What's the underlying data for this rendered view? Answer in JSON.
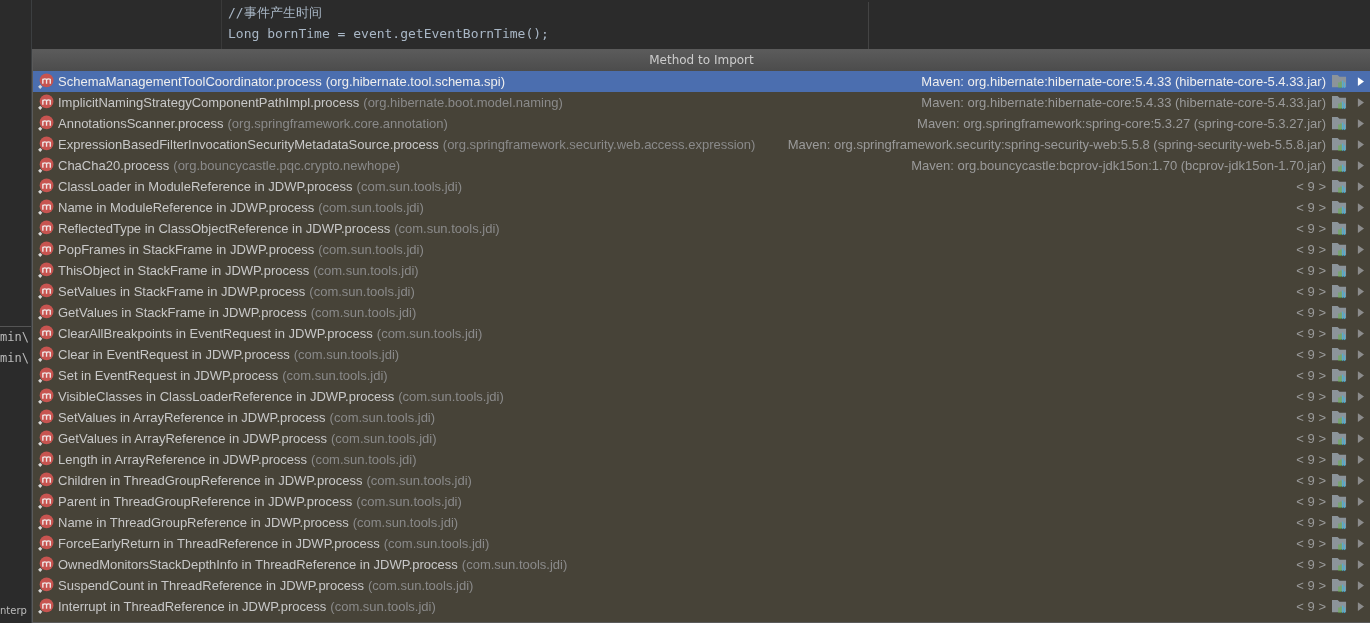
{
  "editor": {
    "lines": [
      "//事件产生时间",
      "Long bornTime = event.getEventBornTime();"
    ]
  },
  "side_panel": {
    "lines": [
      "min\\",
      "min\\",
      "nterp"
    ]
  },
  "popup": {
    "title": "Method to Import",
    "items": [
      {
        "name": "SchemaManagementToolCoordinator.process",
        "package": "(org.hibernate.tool.schema.spi)",
        "location": "Maven: org.hibernate:hibernate-core:5.4.33 (hibernate-core-5.4.33.jar)",
        "selected": true
      },
      {
        "name": "ImplicitNamingStrategyComponentPathImpl.process",
        "package": "(org.hibernate.boot.model.naming)",
        "location": "Maven: org.hibernate:hibernate-core:5.4.33 (hibernate-core-5.4.33.jar)",
        "selected": false
      },
      {
        "name": "AnnotationsScanner.process",
        "package": "(org.springframework.core.annotation)",
        "location": "Maven: org.springframework:spring-core:5.3.27 (spring-core-5.3.27.jar)",
        "selected": false
      },
      {
        "name": "ExpressionBasedFilterInvocationSecurityMetadataSource.process",
        "package": "(org.springframework.security.web.access.expression)",
        "location": "Maven: org.springframework.security:spring-security-web:5.5.8 (spring-security-web-5.5.8.jar)",
        "selected": false
      },
      {
        "name": "ChaCha20.process",
        "package": "(org.bouncycastle.pqc.crypto.newhope)",
        "location": "Maven: org.bouncycastle:bcprov-jdk15on:1.70 (bcprov-jdk15on-1.70.jar)",
        "selected": false
      },
      {
        "name": "ClassLoader in ModuleReference in JDWP.process",
        "package": "(com.sun.tools.jdi)",
        "location": "< 9 >",
        "selected": false
      },
      {
        "name": "Name in ModuleReference in JDWP.process",
        "package": "(com.sun.tools.jdi)",
        "location": "< 9 >",
        "selected": false
      },
      {
        "name": "ReflectedType in ClassObjectReference in JDWP.process",
        "package": "(com.sun.tools.jdi)",
        "location": "< 9 >",
        "selected": false
      },
      {
        "name": "PopFrames in StackFrame in JDWP.process",
        "package": "(com.sun.tools.jdi)",
        "location": "< 9 >",
        "selected": false
      },
      {
        "name": "ThisObject in StackFrame in JDWP.process",
        "package": "(com.sun.tools.jdi)",
        "location": "< 9 >",
        "selected": false
      },
      {
        "name": "SetValues in StackFrame in JDWP.process",
        "package": "(com.sun.tools.jdi)",
        "location": "< 9 >",
        "selected": false
      },
      {
        "name": "GetValues in StackFrame in JDWP.process",
        "package": "(com.sun.tools.jdi)",
        "location": "< 9 >",
        "selected": false
      },
      {
        "name": "ClearAllBreakpoints in EventRequest in JDWP.process",
        "package": "(com.sun.tools.jdi)",
        "location": "< 9 >",
        "selected": false
      },
      {
        "name": "Clear in EventRequest in JDWP.process",
        "package": "(com.sun.tools.jdi)",
        "location": "< 9 >",
        "selected": false
      },
      {
        "name": "Set in EventRequest in JDWP.process",
        "package": "(com.sun.tools.jdi)",
        "location": "< 9 >",
        "selected": false
      },
      {
        "name": "VisibleClasses in ClassLoaderReference in JDWP.process",
        "package": "(com.sun.tools.jdi)",
        "location": "< 9 >",
        "selected": false
      },
      {
        "name": "SetValues in ArrayReference in JDWP.process",
        "package": "(com.sun.tools.jdi)",
        "location": "< 9 >",
        "selected": false
      },
      {
        "name": "GetValues in ArrayReference in JDWP.process",
        "package": "(com.sun.tools.jdi)",
        "location": "< 9 >",
        "selected": false
      },
      {
        "name": "Length in ArrayReference in JDWP.process",
        "package": "(com.sun.tools.jdi)",
        "location": "< 9 >",
        "selected": false
      },
      {
        "name": "Children in ThreadGroupReference in JDWP.process",
        "package": "(com.sun.tools.jdi)",
        "location": "< 9 >",
        "selected": false
      },
      {
        "name": "Parent in ThreadGroupReference in JDWP.process",
        "package": "(com.sun.tools.jdi)",
        "location": "< 9 >",
        "selected": false
      },
      {
        "name": "Name in ThreadGroupReference in JDWP.process",
        "package": "(com.sun.tools.jdi)",
        "location": "< 9 >",
        "selected": false
      },
      {
        "name": "ForceEarlyReturn in ThreadReference in JDWP.process",
        "package": "(com.sun.tools.jdi)",
        "location": "< 9 >",
        "selected": false
      },
      {
        "name": "OwnedMonitorsStackDepthInfo in ThreadReference in JDWP.process",
        "package": "(com.sun.tools.jdi)",
        "location": "< 9 >",
        "selected": false
      },
      {
        "name": "SuspendCount in ThreadReference in JDWP.process",
        "package": "(com.sun.tools.jdi)",
        "location": "< 9 >",
        "selected": false
      },
      {
        "name": "Interrupt in ThreadReference in JDWP.process",
        "package": "(com.sun.tools.jdi)",
        "location": "< 9 >",
        "selected": false
      }
    ]
  }
}
